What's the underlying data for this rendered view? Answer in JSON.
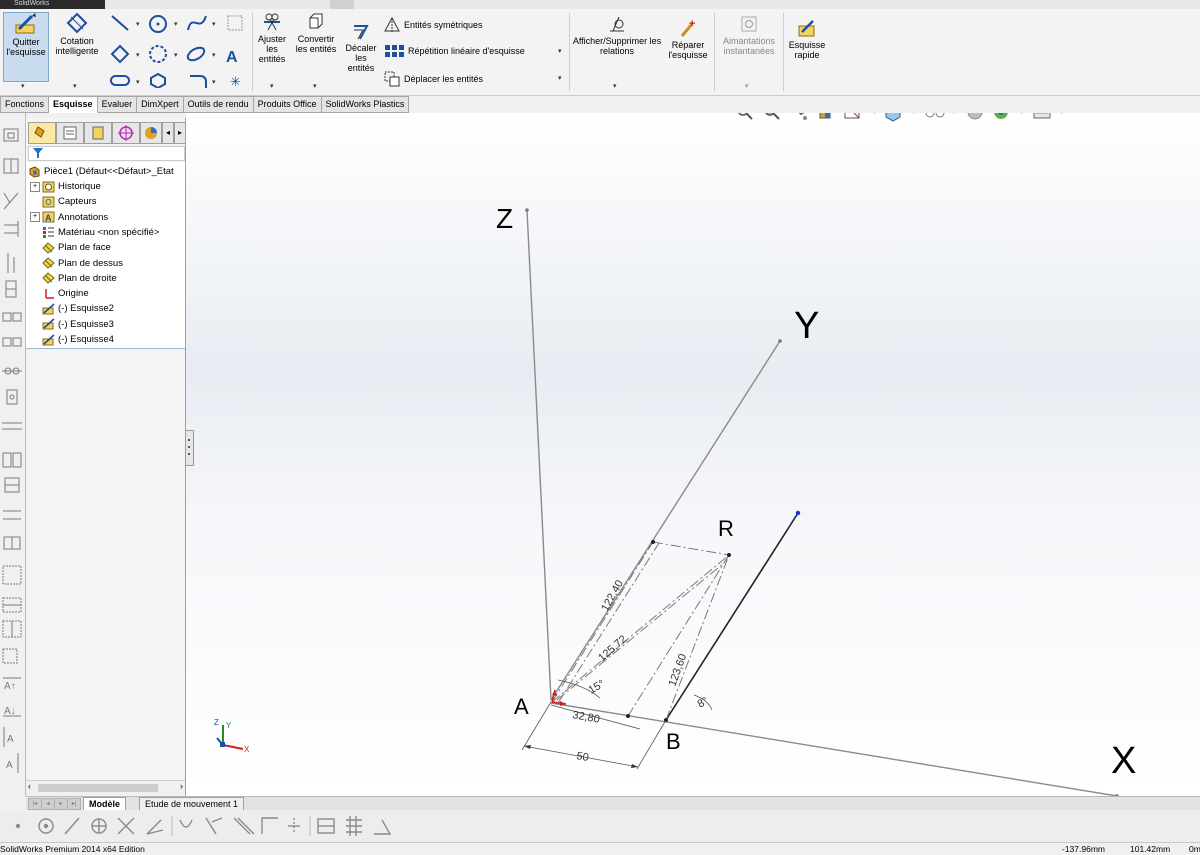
{
  "app": {
    "title_clip": "SolidWorks",
    "status_edition": "SolidWorks Premium 2014 x64 Edition",
    "coord_x": "-137.96mm",
    "coord_y": "101.42mm",
    "coord_z": "0m"
  },
  "ribbon": {
    "exit_sketch": "Quitter l'esquisse",
    "smart_dim_1": "Cotation",
    "smart_dim_2": "intelligente",
    "trim": "Ajuster les entités",
    "convert": "Convertir les entités",
    "offset": "Décaler les entités",
    "mirror": "Entités symétriques",
    "linear_pattern": "Répétition linéaire d'esquisse",
    "move_entities": "Déplacer les entités",
    "display_relations": "Afficher/Supprimer les relations",
    "repair_1": "Réparer",
    "repair_2": "l'esquisse",
    "snaps_1": "Aimantations",
    "snaps_2": "instantanées",
    "rapid_1": "Esquisse",
    "rapid_2": "rapide"
  },
  "command_tabs": [
    "Fonctions",
    "Esquisse",
    "Evaluer",
    "DimXpert",
    "Outils de rendu",
    "Produits Office",
    "SolidWorks Plastics"
  ],
  "command_tab_selected": "Esquisse",
  "tree": {
    "root": "Pièce1  (Défaut<<Défaut>_Etat",
    "items": [
      {
        "label": "Historique",
        "icon": "history-icon",
        "expand": true
      },
      {
        "label": "Capteurs",
        "icon": "sensor-icon",
        "expand": false
      },
      {
        "label": "Annotations",
        "icon": "annotation-icon",
        "expand": true
      },
      {
        "label": "Matériau <non spécifié>",
        "icon": "material-icon",
        "expand": false
      },
      {
        "label": "Plan de face",
        "icon": "plane-icon",
        "expand": false
      },
      {
        "label": "Plan de dessus",
        "icon": "plane-icon",
        "expand": false
      },
      {
        "label": "Plan de droite",
        "icon": "plane-icon",
        "expand": false
      },
      {
        "label": "Origine",
        "icon": "origin-icon",
        "expand": false
      },
      {
        "label": "(-) Esquisse2",
        "icon": "sketch-icon",
        "expand": false
      },
      {
        "label": "(-) Esquisse3",
        "icon": "sketch-icon",
        "expand": false
      },
      {
        "label": "(-) Esquisse4",
        "icon": "sketch-icon",
        "expand": false
      }
    ]
  },
  "bottom_tabs": [
    "Modèle",
    "Etude de mouvement 1"
  ],
  "sketch": {
    "axis_z": "Z",
    "axis_y": "Y",
    "axis_x": "X",
    "point_r": "R",
    "point_a": "A",
    "point_b": "B",
    "dim_122": "122,40",
    "dim_125": "125,72",
    "dim_123": "123,60",
    "dim_32": "32,80",
    "dim_50": "50",
    "angle_15": "15°",
    "angle_8": "8°",
    "triad_y": "Y",
    "triad_z": "Z",
    "triad_x": "X"
  },
  "colors": {
    "accent_blue": "#2a6fc0",
    "active_btn": "#c9dcef",
    "sketch_line": "#555555",
    "construction": "#7a7a7a",
    "point_blue": "#1a2fd6"
  }
}
